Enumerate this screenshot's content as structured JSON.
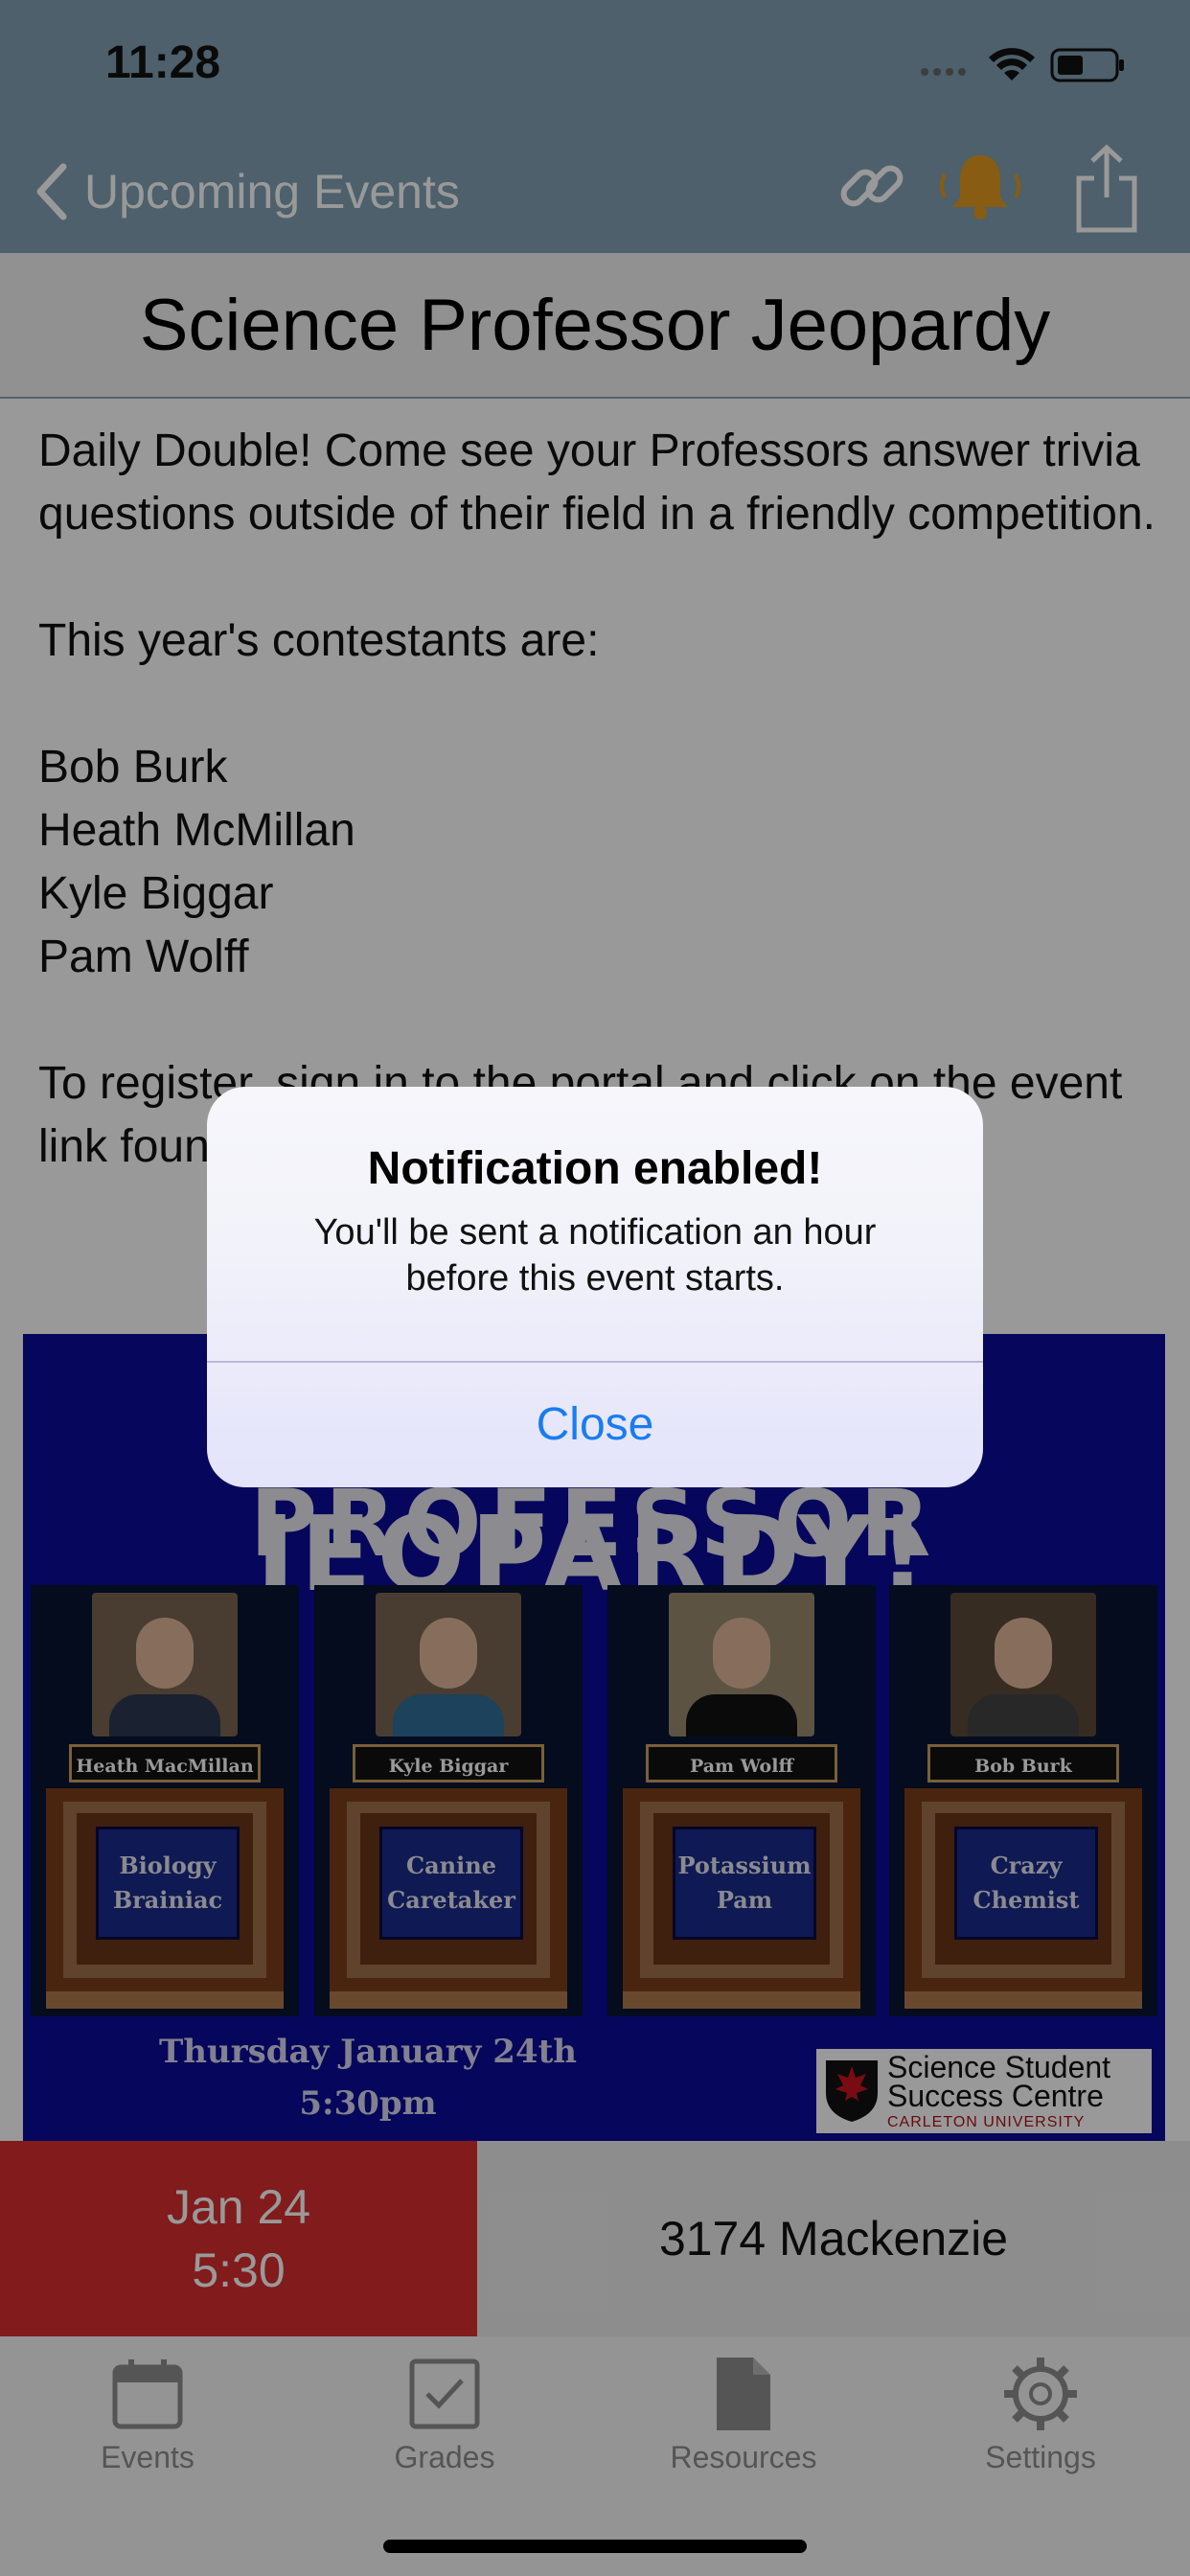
{
  "status_bar": {
    "time": "11:28"
  },
  "nav": {
    "back_label": "Upcoming Events"
  },
  "event": {
    "title": "Science Professor Jeopardy",
    "description": "Daily Double! Come see your Professors answer trivia questions outside of their field in a friendly competition.\n\nThis year's contestants are:\n\nBob Burk\nHeath McMillan\nKyle Biggar\nPam Wolff\n\nTo register, sign in to the portal and click on the event link found under the myS"
  },
  "poster": {
    "headline_top": "SCIENCE PROFESSOR",
    "headline_bottom": "JEOPARDY!",
    "contestants": [
      {
        "name": "Heath MacMillan",
        "nickname": "Biology\nBrainiac"
      },
      {
        "name": "Kyle Biggar",
        "nickname": "Canine\nCaretaker"
      },
      {
        "name": "Pam Wolff",
        "nickname": "Potassium\nPam"
      },
      {
        "name": "Bob Burk",
        "nickname": "Crazy\nChemist"
      }
    ],
    "date_line": "Thursday January 24th",
    "time_line": "5:30pm",
    "logo_line1": "Science Student",
    "logo_line2": "Success Centre",
    "logo_sub": "CARLETON UNIVERSITY"
  },
  "info": {
    "date": "Jan 24",
    "time": "5:30",
    "location": "3174 Mackenzie"
  },
  "tabs": [
    {
      "label": "Events",
      "icon": "calendar-icon"
    },
    {
      "label": "Grades",
      "icon": "checkbox-icon"
    },
    {
      "label": "Resources",
      "icon": "document-icon"
    },
    {
      "label": "Settings",
      "icon": "gear-icon"
    }
  ],
  "alert": {
    "title": "Notification enabled!",
    "message": "You'll be sent a notification an hour before this event starts.",
    "button": "Close"
  },
  "colors": {
    "nav_bg": "#80a0b2",
    "date_red": "#d92e2e",
    "accent_blue": "#1a7cf0",
    "bell": "#e39a1e"
  }
}
